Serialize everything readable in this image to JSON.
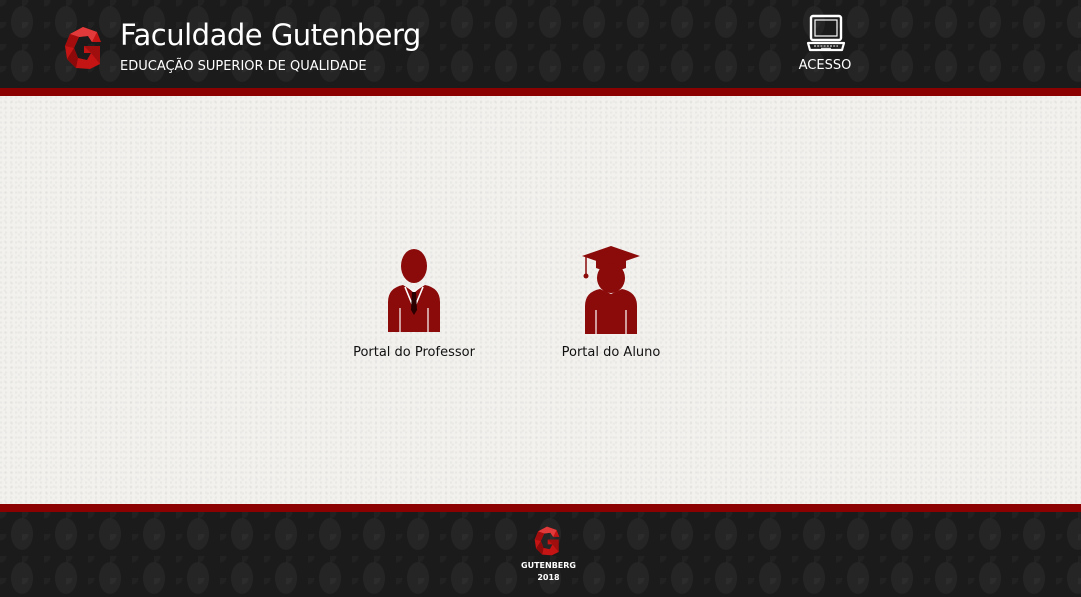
{
  "header": {
    "title": "Faculdade Gutenberg",
    "subtitle": "EDUCAÇÃO SUPERIOR DE QUALIDADE",
    "logo_icon": "gutenberg-g-logo",
    "access": {
      "label": "ACESSO",
      "icon": "laptop-icon"
    }
  },
  "portals": [
    {
      "label": "Portal do Professor",
      "icon": "professor-icon"
    },
    {
      "label": "Portal do Aluno",
      "icon": "graduate-student-icon"
    }
  ],
  "footer": {
    "logo_icon": "gutenberg-g-logo",
    "name": "GUTENBERG",
    "year": "2018"
  },
  "colors": {
    "brand_red": "#8b0000",
    "icon_red": "#8b0a0a",
    "dark_bg": "#1b1b1b",
    "light_bg": "#f2f1ee"
  }
}
